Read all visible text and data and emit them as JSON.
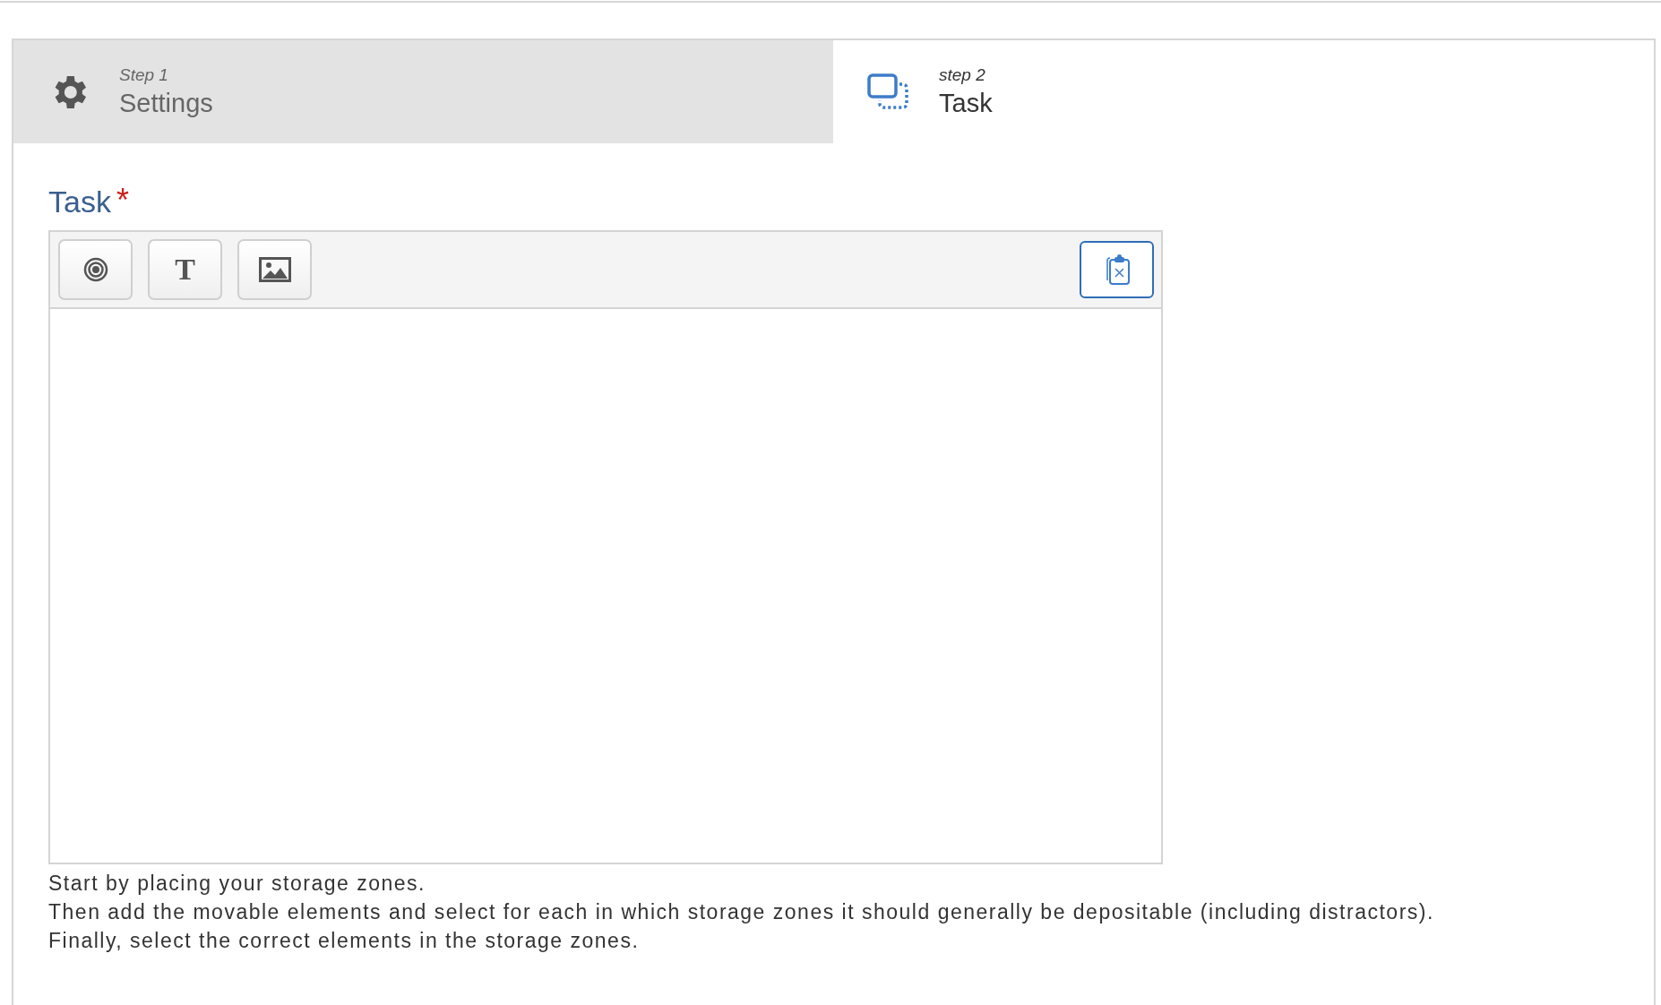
{
  "steps": [
    {
      "kind": "settings",
      "step": "Step 1",
      "label": "Settings",
      "selected": false
    },
    {
      "kind": "task",
      "step": "step 2",
      "label": "Task",
      "selected": true
    }
  ],
  "field": {
    "label": "Task",
    "required_mark": "*"
  },
  "toolbar": {
    "tools": [
      {
        "kind": "target"
      },
      {
        "kind": "text",
        "glyph": "T"
      },
      {
        "kind": "image"
      }
    ]
  },
  "help_lines": [
    "Start by placing your storage zones.",
    "Then add the movable elements and select for each in which storage zones it should generally be depositable (including distractors).",
    "Finally, select the correct elements in the storage zones."
  ]
}
